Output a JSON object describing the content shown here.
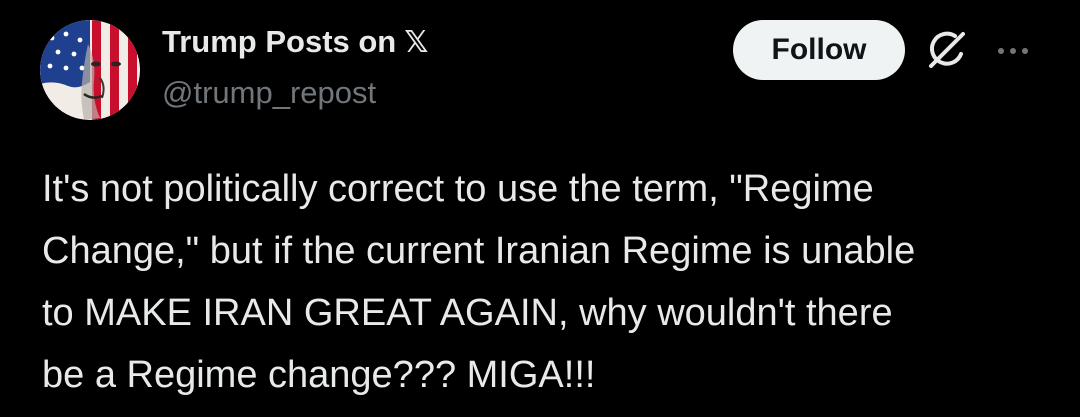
{
  "author": {
    "name": "Trump Posts on",
    "platform_glyph": "𝕏",
    "handle": "@trump_repost",
    "avatar_icon": "flag-portrait-avatar"
  },
  "actions": {
    "follow_label": "Follow",
    "grok_icon": "grok-icon",
    "more_icon": "more-options-icon"
  },
  "post": {
    "text": "It's not politically correct to use the term, \"Regime\nChange,\" but if the current Iranian Regime is unable\nto MAKE IRAN GREAT AGAIN, why wouldn't there\nbe a Regime change??? MIGA!!!"
  },
  "colors": {
    "background": "#000000",
    "text_primary": "#e7e9ea",
    "text_secondary": "#71767b",
    "button_bg": "#eff3f4",
    "button_text": "#0f1419"
  }
}
